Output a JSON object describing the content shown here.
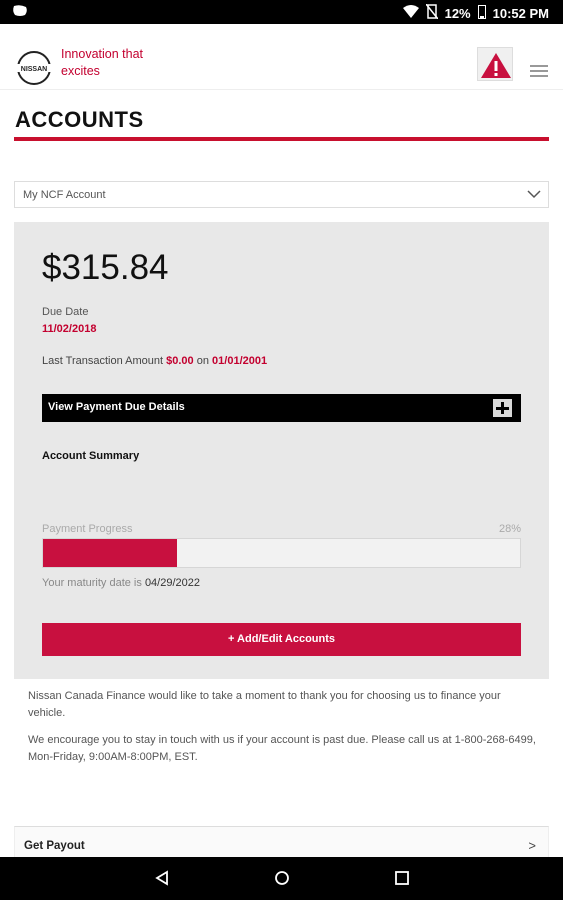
{
  "status_bar": {
    "battery": "12%",
    "time": "10:52 PM"
  },
  "header": {
    "tagline": "Innovation that excites",
    "logo_text": "NISSAN"
  },
  "page": {
    "title": "ACCOUNTS"
  },
  "account_select": {
    "selected": "My NCF Account"
  },
  "account": {
    "amount": "$315.84",
    "due_date_label": "Due Date",
    "due_date": "11/02/2018",
    "last_tx_label": "Last Transaction Amount",
    "last_tx_amount": "$0.00",
    "last_tx_on": "on",
    "last_tx_date": "01/01/2001",
    "details_label": "View Payment Due Details",
    "summary_label": "Account Summary",
    "progress_label": "Payment Progress",
    "progress_percent": "28%",
    "progress_value": 0.28,
    "maturity_label": "Your maturity date is",
    "maturity_date": "04/29/2022",
    "add_button": "+ Add/Edit Accounts"
  },
  "messages": {
    "thanks": "Nissan Canada Finance would like to take a moment to thank you for choosing us to finance your vehicle.",
    "contact": "We encourage you to stay in touch with us if your account is past due. Please call us at 1-800-268-6499, Mon-Friday, 9:00AM-8:00PM, EST."
  },
  "payout": {
    "label": "Get Payout",
    "arrow": ">"
  },
  "colors": {
    "brand_red": "#c3002f",
    "accent_red": "#c8103f"
  }
}
